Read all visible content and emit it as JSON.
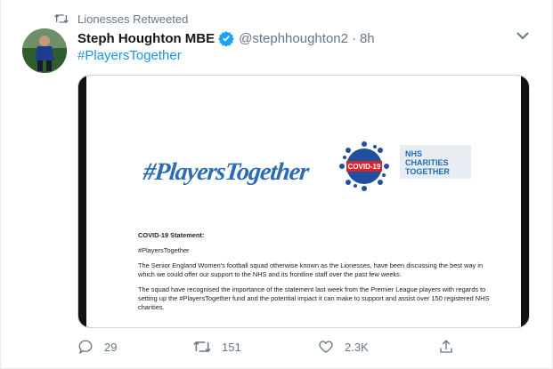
{
  "retweet": {
    "label": "Lionesses Retweeted"
  },
  "author": {
    "name": "Steph Houghton MBE",
    "handle": "@stephhoughton2",
    "separator": "·",
    "time": "8h"
  },
  "tweet": {
    "hashtag": "#PlayersTogether"
  },
  "media": {
    "logo_text": "#PlayersTogether",
    "nhs_line1": "NHS CHARITIES",
    "nhs_line2": "TOGETHER",
    "statement_heading": "COVID-19 Statement:",
    "statement_hashtag": "#PlayersTogether",
    "paragraph1": "The Senior England Women's football squad otherwise known as the Lionesses, have been discussing the best way in which we could offer our support to the NHS and its frontline staff over the past few weeks.",
    "paragraph2": "The squad have recognised the importance of the statement last week from the Premier League players with regards to setting up the #PlayersTogether fund and the potential impact it can make to support and assist over 150 registered NHS charities."
  },
  "actions": {
    "replies": "29",
    "retweets": "151",
    "likes": "2.3K"
  },
  "colors": {
    "link": "#1b95e0",
    "muted": "#657786",
    "verified": "#1da1f2",
    "retweet_green": "#17bf63"
  }
}
